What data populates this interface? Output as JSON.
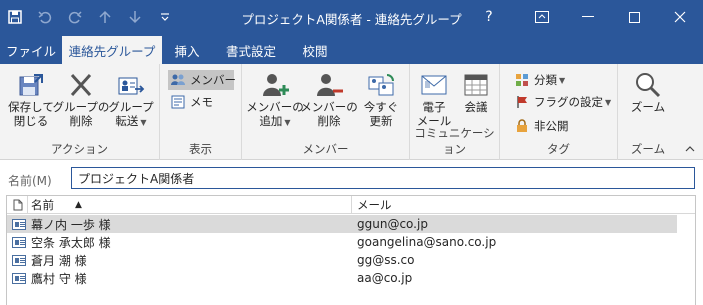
{
  "window": {
    "title": "プロジェクトA関係者  -  連絡先グループ",
    "help": "?",
    "qat": {
      "save_icon": "save-icon",
      "undo_icon": "undo-icon",
      "redo_icon": "redo-icon",
      "up_icon": "up-arrow-icon",
      "down_icon": "down-arrow-icon",
      "customize_icon": "customize-qat-icon"
    }
  },
  "tabs": [
    {
      "label": "ファイル"
    },
    {
      "label": "連絡先グループ"
    },
    {
      "label": "挿入"
    },
    {
      "label": "書式設定"
    },
    {
      "label": "校閲"
    }
  ],
  "ribbon": {
    "action": {
      "label": "アクション",
      "save_close": [
        "保存して",
        "閉じる"
      ],
      "delete_group": [
        "グループの",
        "削除"
      ],
      "forward_group": [
        "グループ",
        "転送"
      ]
    },
    "view": {
      "label": "表示",
      "members": "メンバー",
      "notes": "メモ"
    },
    "members": {
      "label": "メンバー",
      "add": [
        "メンバーの",
        "追加"
      ],
      "remove": [
        "メンバーの",
        "削除"
      ],
      "update": [
        "今すぐ",
        "更新"
      ]
    },
    "communication": {
      "label": "コミュニケーション",
      "email": [
        "電子",
        "メール"
      ],
      "meeting": "会議"
    },
    "tags": {
      "label": "タグ",
      "categorize": "分類",
      "follow_up": "フラグの設定",
      "private": "非公開"
    },
    "zoom": {
      "label": "ズーム",
      "zoom": "ズーム"
    }
  },
  "name_field": {
    "label": "名前(M)",
    "value": "プロジェクトA関係者"
  },
  "table": {
    "columns": {
      "name": "名前",
      "email": "メール"
    },
    "rows": [
      {
        "name": " 幕ノ内 一歩 様",
        "email": "ggun@co.jp",
        "selected": true
      },
      {
        "name": "空条 承太郎 様",
        "email": "goangelina@sano.co.jp",
        "selected": false
      },
      {
        "name": "蒼月 潮 様",
        "email": "gg@ss.co",
        "selected": false
      },
      {
        "name": "鷹村 守 様",
        "email": "aa@co.jp",
        "selected": false
      }
    ]
  },
  "colors": {
    "accent": "#2b579a",
    "ribbon_bg": "#f3f3f3",
    "selected_row": "#dadada"
  }
}
